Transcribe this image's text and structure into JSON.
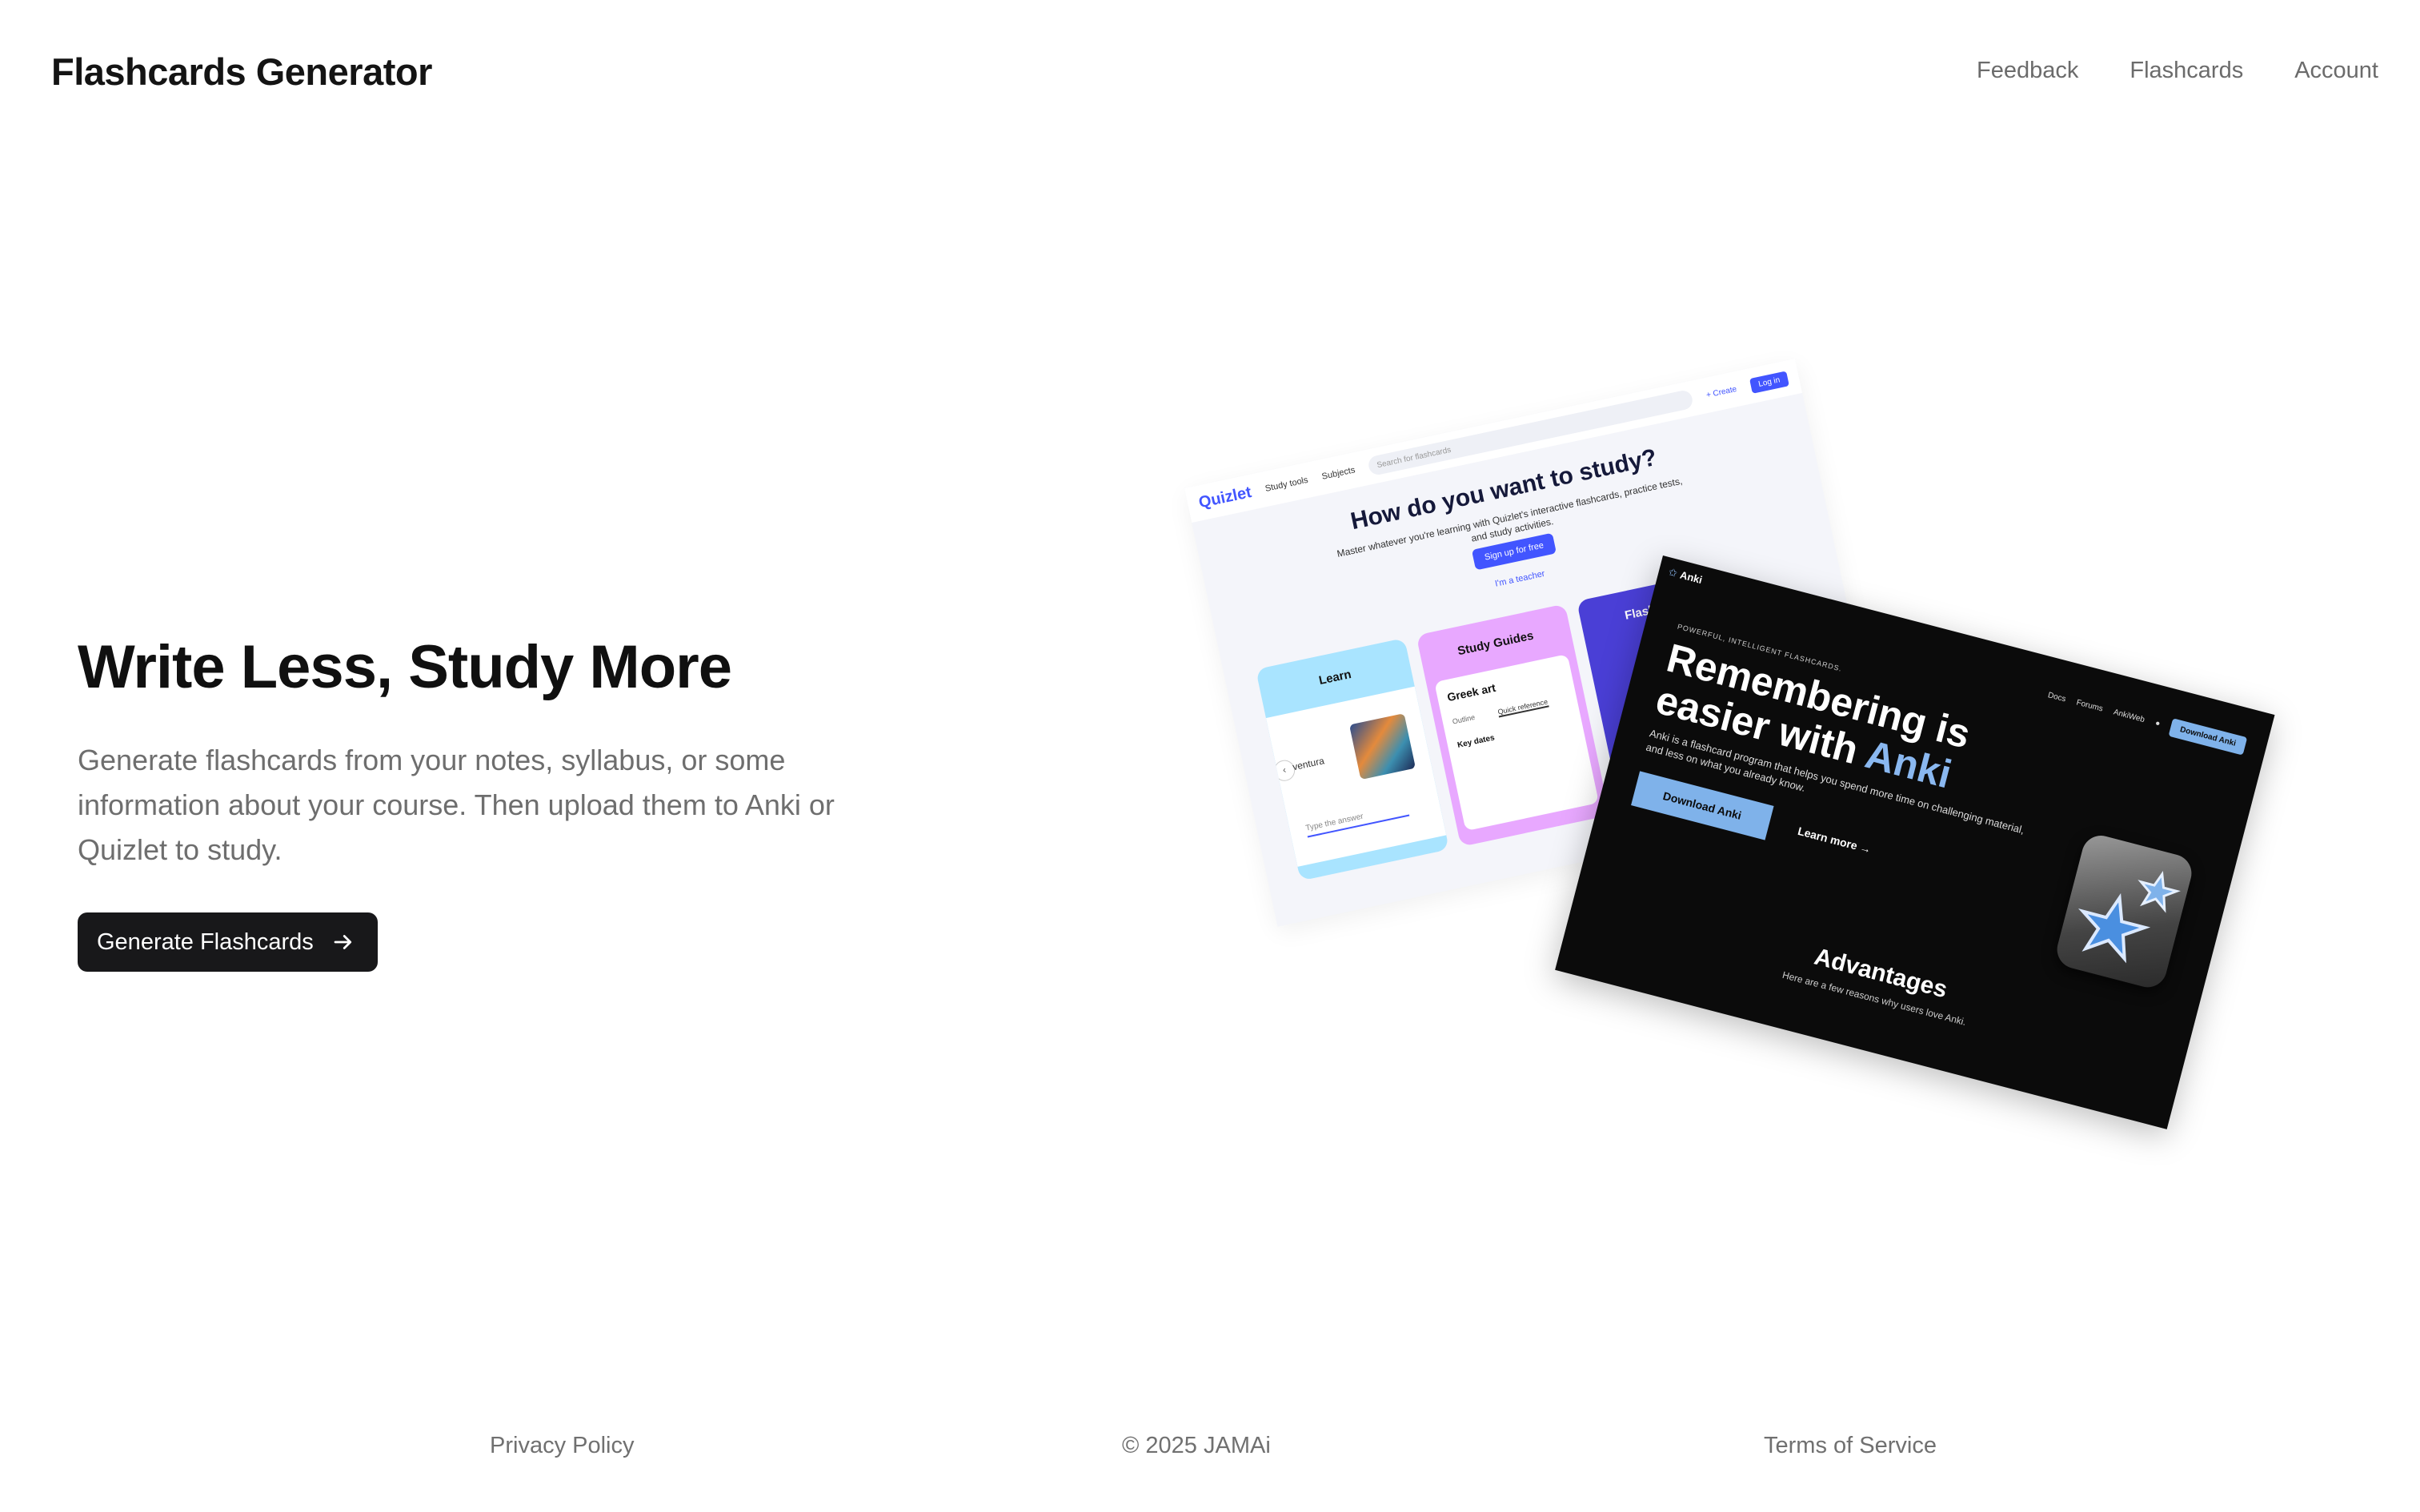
{
  "header": {
    "brand": "Flashcards Generator",
    "nav": [
      "Feedback",
      "Flashcards",
      "Account"
    ]
  },
  "hero": {
    "title": "Write Less, Study More",
    "description": "Generate flashcards from your notes, syllabus, or some information about your course. Then upload them to Anki or Quizlet to study.",
    "cta_label": "Generate Flashcards",
    "cta_icon": "arrow-right-icon"
  },
  "quizlet_preview": {
    "logo": "Quizlet",
    "nav": [
      "Study tools",
      "Subjects"
    ],
    "search_placeholder": "Search for flashcards",
    "create": "+ Create",
    "login": "Log in",
    "heading": "How do you want to study?",
    "subheading": "Master whatever you're learning with Quizlet's interactive flashcards, practice tests, and study activities.",
    "signup": "Sign up for free",
    "teacher": "I'm a teacher",
    "cards": [
      "Learn",
      "Study Guides",
      "Flashcards"
    ],
    "learn_word": "ventura",
    "answer_placeholder": "Type the answer",
    "study_title": "Greek art",
    "study_tabs": [
      "Outline",
      "Quick reference"
    ],
    "key_dates": "Key dates"
  },
  "anki_preview": {
    "logo": "Anki",
    "nav": [
      "Docs",
      "Forums",
      "AnkiWeb"
    ],
    "download_nav": "Download Anki",
    "eyebrow": "POWERFUL, INTELLIGENT FLASHCARDS.",
    "heading_line1": "Remembering is",
    "heading_line2a": "easier with ",
    "heading_line2b": "Anki",
    "paragraph": "Anki is a flashcard program that helps you spend more time on challenging material, and less on what you already know.",
    "download": "Download Anki",
    "learn_more": "Learn more →",
    "advantages": "Advantages",
    "advantages_sub": "Here are a few reasons why users love Anki."
  },
  "footer": {
    "privacy": "Privacy Policy",
    "copyright": "© 2025 JAMAi",
    "terms": "Terms of Service"
  }
}
